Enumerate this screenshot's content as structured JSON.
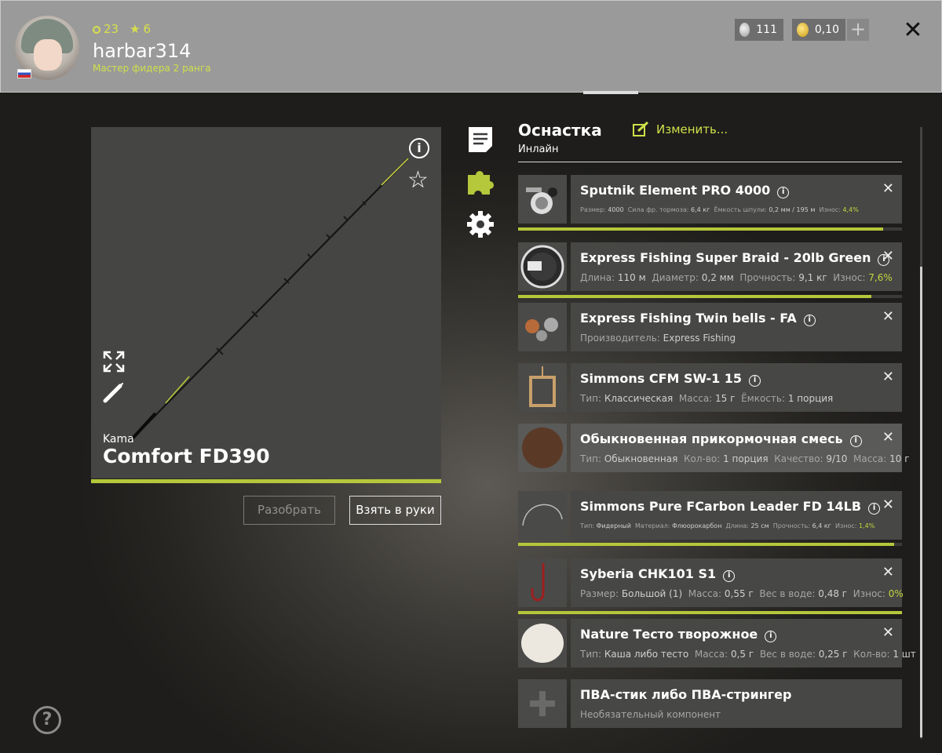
{
  "profile": {
    "level": "23",
    "stars": "6",
    "username": "harbar314",
    "rank": "Мастер фидера 2 ранга",
    "silver": "111",
    "gold": "0,10",
    "plus_label": "+"
  },
  "rod": {
    "brand": "Kama",
    "name": "Comfort FD390",
    "disassemble_label": "Разобрать",
    "take_label": "Взять в руки"
  },
  "tackle": {
    "title": "Оснастка",
    "subtitle": "Инлайн",
    "edit_label": "Изменить..."
  },
  "components": [
    {
      "title": "Sputnik Element PRO 4000",
      "k1": "Размер: ",
      "v1": "4000",
      "k2": "Сила фр. тормоза: ",
      "v2": "6,4 кг",
      "k3": "Ёмкость шпули: ",
      "v3": "0,2 мм / 195 м",
      "k4": "Износ: ",
      "v4": "4,4%",
      "wear_pct": 95
    },
    {
      "title": "Express Fishing Super Braid - 20lb Green",
      "k1": "Длина: ",
      "v1": "110 м",
      "k2": "Диаметр: ",
      "v2": "0,2 мм",
      "k3": "Прочность: ",
      "v3": "9,1 кг",
      "k4": "Износ: ",
      "v4": "7,6%",
      "wear_pct": 92
    },
    {
      "title": "Express Fishing Twin bells - FA",
      "k1": "Производитель: ",
      "v1": "Express Fishing"
    },
    {
      "title": "Simmons CFM SW-1 15",
      "k1": "Тип: ",
      "v1": "Классическая",
      "k2": "Масса: ",
      "v2": "15 г",
      "k3": "Ёмкость: ",
      "v3": "1 порция"
    },
    {
      "title": "Обыкновенная прикормочная смесь",
      "k1": "Тип: ",
      "v1": "Обыкновенная",
      "k2": "Кол-во: ",
      "v2": "1 порция",
      "k3": "Качество: ",
      "v3": "9/10",
      "k4": "Масса: ",
      "v4": "10 г"
    },
    {
      "title": "Simmons Pure FCarbon Leader FD 14LB",
      "k1": "Тип: ",
      "v1": "Фидерный",
      "k2": "Материал: ",
      "v2": "Флюорокарбон",
      "k3": "Длина: ",
      "v3": "25 см",
      "k4": "Прочность: ",
      "v4": "6,4 кг",
      "k5": "Износ: ",
      "v5": "1,4%",
      "wear_pct": 98
    },
    {
      "title": "Syberia CHK101 S1",
      "k1": "Размер: ",
      "v1": "Большой (1)",
      "k2": "Масса: ",
      "v2": "0,55 г",
      "k3": "Вес в воде: ",
      "v3": "0,48 г",
      "k4": "Износ: ",
      "v4": "0%",
      "wear_pct": 100
    },
    {
      "title": "Nature Тесто творожное",
      "k1": "Тип: ",
      "v1": "Каша либо тесто",
      "k2": "Масса: ",
      "v2": "0,5 г",
      "k3": "Вес в воде: ",
      "v3": "0,25 г",
      "k4": "Кол-во: ",
      "v4": "1 шт"
    },
    {
      "title": "ПВА-стик либо ПВА-стрингер",
      "k1": "Необязательный компонент"
    }
  ],
  "help_label": "?",
  "close_label": "✕",
  "colors": {
    "accent": "#b5c73a",
    "accent_text": "#cfe04a"
  }
}
